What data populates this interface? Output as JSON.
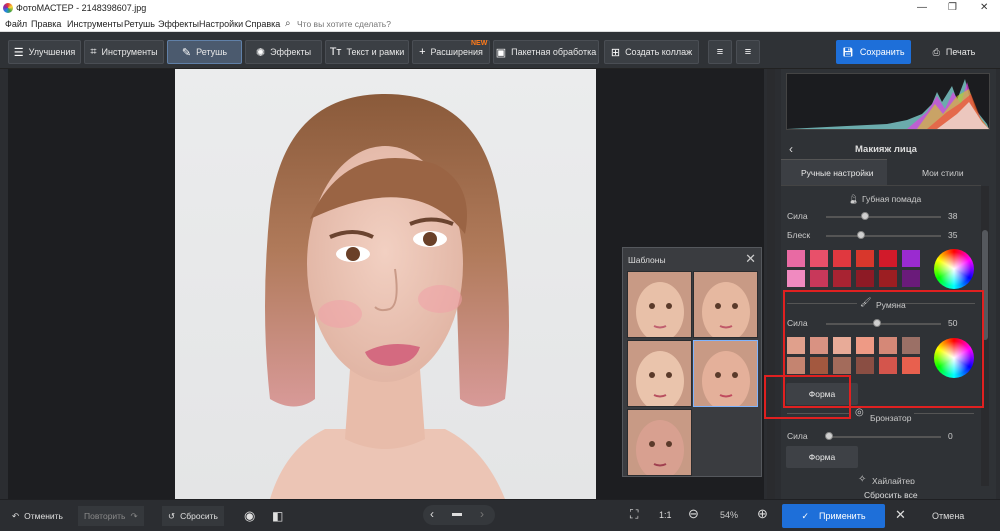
{
  "window": {
    "title": "ФотоМАСТЕР - 2148398607.jpg"
  },
  "menu": {
    "items": [
      "Файл",
      "Правка",
      "Инструменты",
      "Ретушь",
      "Эффекты",
      "Настройки",
      "Справка"
    ],
    "search_placeholder": "Что вы хотите сделать?"
  },
  "toolbar": {
    "tabs": [
      "Улучшения",
      "Инструменты",
      "Ретушь",
      "Эффекты",
      "Текст и рамки",
      "Расширения",
      "Пакетная обработка",
      "Создать коллаж"
    ],
    "new_badge": "NEW",
    "save_label": "Сохранить",
    "print_label": "Печать"
  },
  "templates": {
    "title": "Шаблоны"
  },
  "panel": {
    "title": "Макияж лица",
    "tabs": [
      "Ручные настройки",
      "Мои стили"
    ],
    "lipstick": {
      "label": "Губная помада",
      "strength_label": "Сила",
      "strength": 38,
      "gloss_label": "Блеск",
      "gloss": 35,
      "swatches": [
        "#e86aa3",
        "#e8506a",
        "#e0383f",
        "#d8372c",
        "#d11a2a",
        "#9a2bd0",
        "#f08ac0",
        "#c8385a",
        "#a82332",
        "#8d1a25",
        "#9c1e22",
        "#6a1b7a"
      ]
    },
    "blush": {
      "label": "Румяна",
      "strength_label": "Сила",
      "strength": 50,
      "form_label": "Форма",
      "swatches": [
        "#e0a08c",
        "#d99282",
        "#e8ab98",
        "#ee9a85",
        "#d58877",
        "#9b7066",
        "#c48470",
        "#a3583f",
        "#a36b5b",
        "#8a4e43",
        "#d4554c",
        "#e8604e"
      ]
    },
    "bronzer": {
      "label": "Бронзатор",
      "strength_label": "Сила",
      "strength": 0,
      "form_label": "Форма"
    },
    "highlighter": {
      "label": "Хайлайтер"
    },
    "reset_all": "Сбросить все"
  },
  "bottom": {
    "undo": "Отменить",
    "redo": "Повторить",
    "reset": "Сбросить",
    "ratio": "1:1",
    "zoom": "54%",
    "apply": "Применить",
    "cancel": "Отмена"
  },
  "colors": {
    "accent": "#1e6fd9",
    "highlight": "#e02020"
  }
}
